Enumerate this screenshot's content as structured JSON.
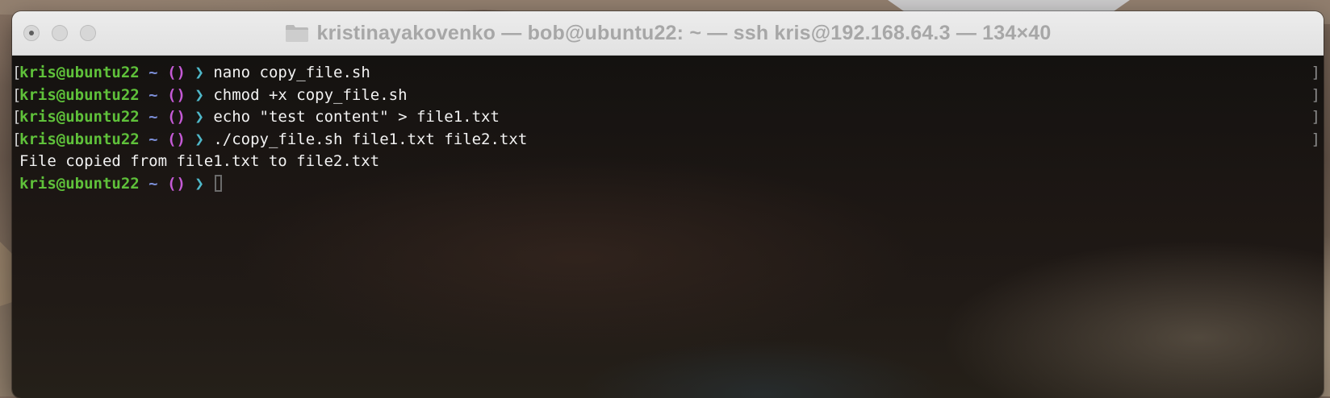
{
  "window": {
    "title": "kristinayakovenko — bob@ubuntu22: ~ — ssh kris@192.168.64.3 — 134×40",
    "title_icon": "folder-icon"
  },
  "prompt": {
    "user_host": "kris@ubuntu22",
    "path": "~",
    "vcs_symbol": "()",
    "arrow": "❯"
  },
  "terminal_lines": [
    {
      "type": "command",
      "text": "nano copy_file.sh"
    },
    {
      "type": "command",
      "text": "chmod +x copy_file.sh"
    },
    {
      "type": "command",
      "text": "echo \"test content\" > file1.txt"
    },
    {
      "type": "command",
      "text": "./copy_file.sh file1.txt file2.txt"
    },
    {
      "type": "output",
      "text": "File copied from file1.txt to file2.txt"
    },
    {
      "type": "prompt",
      "text": ""
    }
  ],
  "colors": {
    "user_host": "#5fc13a",
    "path": "#7c8fd8",
    "vcs_symbol": "#c55ad6",
    "arrow": "#4fb8c9",
    "text": "#f2f2f2"
  }
}
